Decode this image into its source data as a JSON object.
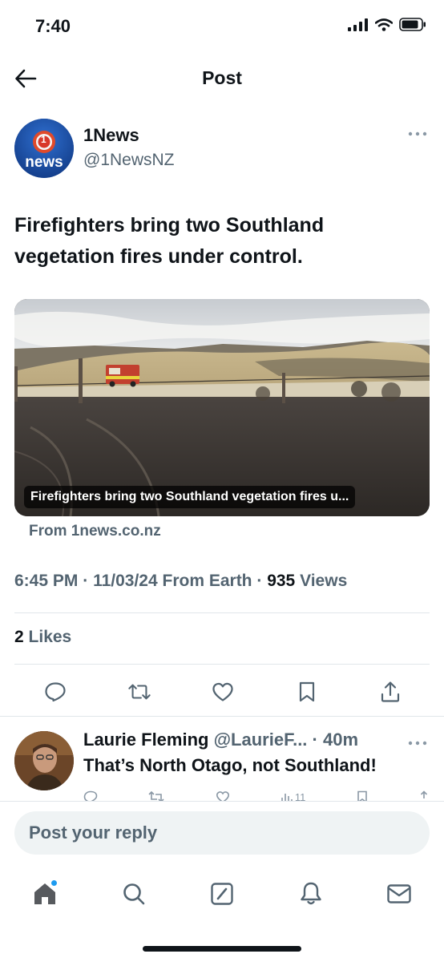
{
  "status_bar": {
    "time": "7:40"
  },
  "header": {
    "title": "Post"
  },
  "author": {
    "name": "1News",
    "handle": "@1NewsNZ",
    "avatar_text": "news",
    "avatar_badge": "1"
  },
  "post": {
    "text": "Firefighters bring two Southland vegetation fires under control.",
    "card_caption": "Firefighters bring two Southland vegetation fires u...",
    "card_source": "From 1news.co.nz",
    "time": "6:45 PM",
    "date": "11/03/24",
    "from": "From Earth",
    "views_count": "935",
    "views_label": "Views",
    "likes_count": "2",
    "likes_label": "Likes"
  },
  "actions": [
    "reply-icon",
    "repost-icon",
    "like-icon",
    "bookmark-icon",
    "share-icon"
  ],
  "reply": {
    "name": "Laurie Fleming",
    "handle": "@LaurieF...",
    "time": "40m",
    "text": "That’s North Otago, not Southland!",
    "views": "11"
  },
  "reply_box": {
    "placeholder": "Post your reply"
  },
  "tabs": [
    "home-icon",
    "search-icon",
    "grok-icon",
    "notifications-icon",
    "messages-icon"
  ],
  "colors": {
    "accent": "#1d9bf0",
    "text": "#0f1419",
    "muted": "#536471",
    "divider": "#e1e6ea"
  }
}
